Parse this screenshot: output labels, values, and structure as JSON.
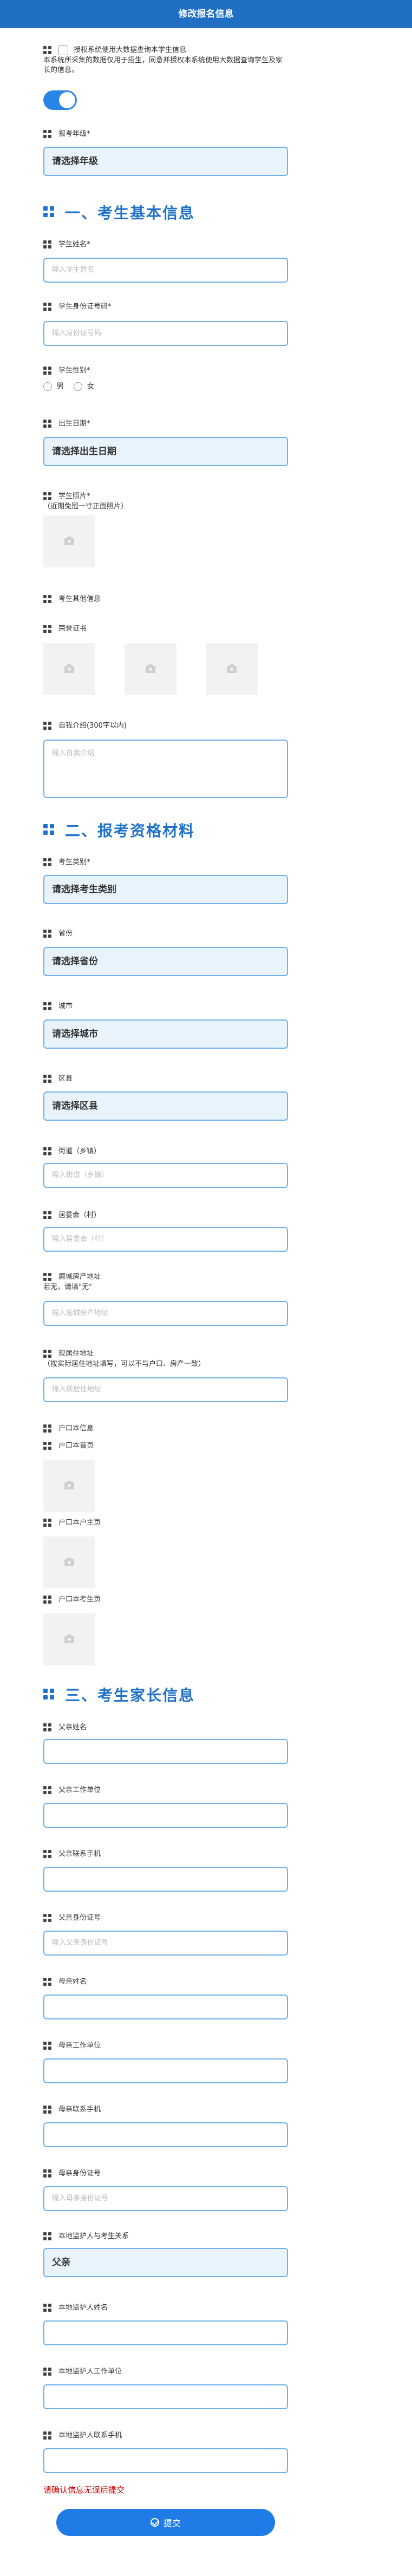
{
  "header": {
    "title": "修改报名信息"
  },
  "consent": {
    "label": "授权系统使用大数据查询本学生信息",
    "description": "本系统所采集的数据仅用于招生，同意并授权本系统使用大数据查询学生及家长的信息。"
  },
  "grade": {
    "label": "报考年级",
    "required": "*",
    "value": "请选择年级"
  },
  "section1": {
    "title": "一、考生基本信息"
  },
  "name": {
    "label": "学生姓名",
    "required": "*",
    "placeholder": "输入学生姓名"
  },
  "id_number": {
    "label": "学生身份证号码",
    "required": "*",
    "placeholder": "输入身份证号码"
  },
  "gender": {
    "label": "学生性别",
    "required": "*",
    "options": [
      "男",
      "女"
    ]
  },
  "birthdate": {
    "label": "出生日期",
    "required": "*",
    "value": "请选择出生日期"
  },
  "photo": {
    "label": "学生照片",
    "required": "*",
    "note": "（近期免冠一寸正面照片）"
  },
  "other_info": {
    "label": "考生其他信息"
  },
  "honors": {
    "label": "荣誉证书"
  },
  "intro": {
    "label": "自我介绍(300字以内)",
    "placeholder": "输入自我介绍"
  },
  "section2": {
    "title": "二、报考资格材料"
  },
  "category": {
    "label": "考生类别",
    "required": "*",
    "value": "请选择考生类别"
  },
  "province": {
    "label": "省份",
    "value": "请选择省份"
  },
  "city": {
    "label": "城市",
    "value": "请选择城市"
  },
  "district": {
    "label": "区县",
    "value": "请选择区县"
  },
  "street": {
    "label": "街道（乡镇）",
    "placeholder": "输入街道（乡镇）"
  },
  "committee": {
    "label": "居委会（村）",
    "placeholder": "输入居委会（村）"
  },
  "property": {
    "label": "鹿城房产地址",
    "note": "若无，请填\"无\"",
    "placeholder": "输入鹿城房产地址"
  },
  "residence": {
    "label": "现居住地址",
    "note": "（按实际居住地址填写，可以不与户口、房产一致）",
    "placeholder": "输入现居住地址"
  },
  "hukou": {
    "label": "户口本信息",
    "home": "户口本首页",
    "head": "户口本户主页",
    "student": "户口本考生页"
  },
  "section3": {
    "title": "三、考生家长信息"
  },
  "father_name": {
    "label": "父亲姓名"
  },
  "father_work": {
    "label": "父亲工作单位"
  },
  "father_phone": {
    "label": "父亲联系手机"
  },
  "father_id": {
    "label": "父亲身份证号",
    "placeholder": "输入父亲身份证号"
  },
  "mother_name": {
    "label": "母亲姓名"
  },
  "mother_work": {
    "label": "母亲工作单位"
  },
  "mother_phone": {
    "label": "母亲联系手机"
  },
  "mother_id": {
    "label": "母亲身份证号",
    "placeholder": "输入母亲身份证号"
  },
  "guardian_relation": {
    "label": "本地监护人与考生关系",
    "value": "父亲"
  },
  "guardian_name": {
    "label": "本地监护人姓名"
  },
  "guardian_work": {
    "label": "本地监护人工作单位"
  },
  "guardian_phone": {
    "label": "本地监护人联系手机"
  },
  "warning": "请确认信息无误后提交",
  "submit": {
    "label": "提交"
  },
  "colors": {
    "header": "#1f6fc3",
    "accent": "#1f72c8",
    "border": "#6fb0e8",
    "warning": "#d00000",
    "button": "#1f7be6"
  }
}
